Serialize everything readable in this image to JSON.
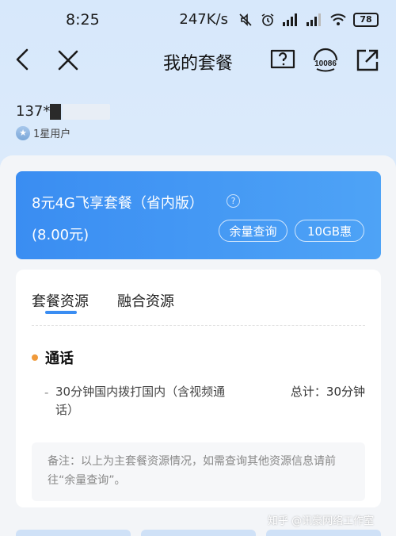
{
  "status_bar": {
    "time": "8:25",
    "net_speed": "247K/s",
    "battery": "78"
  },
  "nav": {
    "title": "我的套餐",
    "service_label": "10086"
  },
  "user": {
    "phone_prefix": "137*",
    "level": "1星用户"
  },
  "plan": {
    "name": "8元4G飞享套餐（省内版）",
    "price": "(8.00元)",
    "balance_button": "余量查询",
    "bonus_button": "10GB惠",
    "help_glyph": "?"
  },
  "resources": {
    "tabs": [
      {
        "label": "套餐资源"
      },
      {
        "label": "融合资源"
      }
    ],
    "section_title": "通话",
    "items": [
      {
        "description": "30分钟国内拨打国内（含视频通话）",
        "total": "总计：30分钟"
      }
    ],
    "note": "备注：以上为主套餐资源情况，如需查询其他资源信息请前往“余量查询”。"
  },
  "watermark": "知乎 @讯豪网络工作室",
  "colors": {
    "accent": "#3a8df2",
    "dot": "#f09a3b"
  }
}
